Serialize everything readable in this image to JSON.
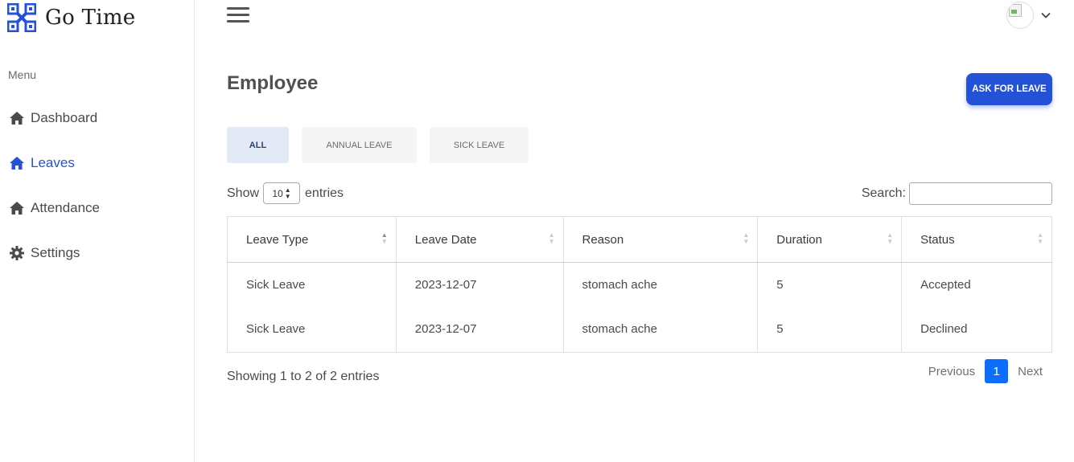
{
  "brand": {
    "name": "Go Time",
    "logo_icon": "grid-logo-icon",
    "logo_color": "#2452d6"
  },
  "sidebar": {
    "menu_label": "Menu",
    "items": [
      {
        "label": "Dashboard",
        "icon": "home-icon",
        "active": false
      },
      {
        "label": "Leaves",
        "icon": "home-icon",
        "active": true
      },
      {
        "label": "Attendance",
        "icon": "home-icon",
        "active": false
      },
      {
        "label": "Settings",
        "icon": "gear-icon",
        "active": false
      }
    ]
  },
  "header": {
    "menu_icon": "hamburger-icon",
    "user_menu_icon": "chevron-down-icon"
  },
  "main": {
    "title": "Employee",
    "ask_button": "ASK FOR LEAVE",
    "tabs": [
      {
        "label": "ALL",
        "active": true
      },
      {
        "label": "ANNUAL LEAVE",
        "active": false
      },
      {
        "label": "SICK LEAVE",
        "active": false
      }
    ],
    "show_label": "Show",
    "entries_label": "entries",
    "page_length": "10",
    "search_label": "Search:",
    "search_value": "",
    "table": {
      "columns": [
        "Leave Type",
        "Leave Date",
        "Reason",
        "Duration",
        "Status"
      ],
      "rows": [
        {
          "leave_type": "Sick Leave",
          "leave_date": "2023-12-07",
          "reason": "stomach ache",
          "duration": "5",
          "status": "Accepted"
        },
        {
          "leave_type": "Sick Leave",
          "leave_date": "2023-12-07",
          "reason": "stomach ache",
          "duration": "5",
          "status": "Declined"
        }
      ]
    },
    "info": "Showing 1 to 2 of 2 entries",
    "pagination": {
      "previous": "Previous",
      "current": "1",
      "next": "Next"
    }
  },
  "colors": {
    "accent": "#2452d6",
    "accepted": "#2c5ec9",
    "declined": "#e0463e",
    "page_active": "#0d6efd"
  }
}
